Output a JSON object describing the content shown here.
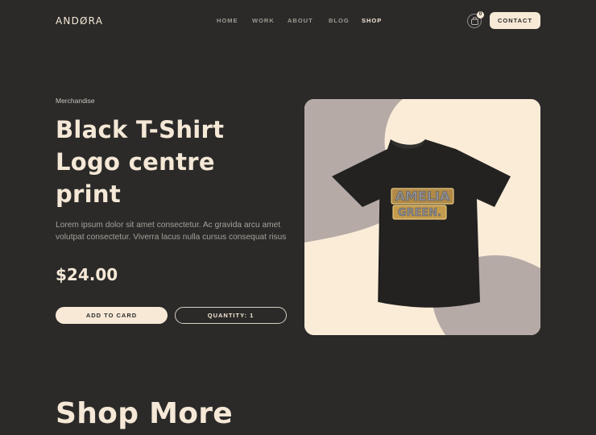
{
  "header": {
    "logo": "ANDØRA",
    "nav": [
      {
        "label": "HOME",
        "active": false
      },
      {
        "label": "WORK",
        "active": false
      },
      {
        "label": "ABOUT",
        "active": false
      },
      {
        "label": "BLOG",
        "active": false
      },
      {
        "label": "SHOP",
        "active": true
      }
    ],
    "cart_count": "0",
    "contact_label": "CONTACT"
  },
  "product": {
    "category": "Merchandise",
    "title_lines": [
      "Black T-Shirt",
      "Logo centre",
      "print"
    ],
    "description": "Lorem ipsum dolor sit amet consectetur. Ac gravida arcu amet volutpat consectetur. Viverra lacus nulla cursus consequat risus",
    "price": "$24.00",
    "add_to_cart_label": "ADD TO CARD",
    "quantity_label": "QUANTITY: 1",
    "print_lines": [
      "AMELIA",
      "GREEN."
    ]
  },
  "shop_more": {
    "title": "Shop More"
  },
  "colors": {
    "background": "#2b2a29",
    "cream": "#f8e9d7",
    "taupe": "#b5aaa6",
    "shirt": "#232221",
    "gold": "#c49a4c"
  }
}
